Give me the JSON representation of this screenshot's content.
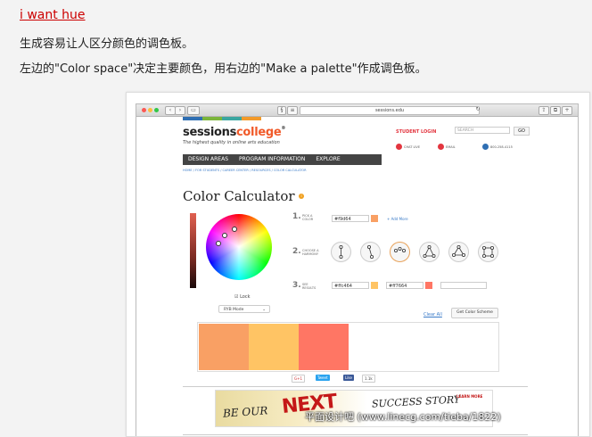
{
  "header": {
    "link_text": "i want hue",
    "line1": "生成容易让人区分颜色的调色板。",
    "line2": "左边的\"Color space\"决定主要颜色，用右边的\"Make a palette\"作成调色板。"
  },
  "browser": {
    "url": "sessions.edu"
  },
  "site": {
    "logo_main": "sessions",
    "logo_accent": "college",
    "logo_suffix": "®",
    "tagline": "The highest quality in online arts education",
    "student_login": "STUDENT LOGIN",
    "search_placeholder": "SEARCH",
    "go_label": "GO",
    "chat_label": "CHAT LIVE",
    "email_label": "EMAIL",
    "phone_label": "800-258-4115",
    "nav": [
      "DESIGN AREAS",
      "PROGRAM INFORMATION",
      "EXPLORE"
    ],
    "breadcrumb": "HOME / FOR STUDENTS / CAREER CENTER / RESOURCES / COLOR CALCULATOR"
  },
  "calculator": {
    "title": "Color Calculator",
    "info_glyph": "i",
    "lock_label": "Lock",
    "mode_label": "RYB Mode",
    "step1_num": "1.",
    "step1_label": "PICK A COLOR",
    "step1_hex": "#f9d64",
    "step1_color": "#f9a064",
    "add_more": "+ Add More",
    "step2_num": "2.",
    "step2_label": "CHOOSE A HARMONY",
    "step3_num": "3.",
    "step3_label": "SEE RESULTS",
    "result1_hex": "#ffc464",
    "result1_color": "#ffc464",
    "result2_hex": "#ff7664",
    "result2_color": "#ff7664",
    "clear_all": "Clear All",
    "get_scheme": "Get Color Scheme",
    "palette": [
      "#f9a064",
      "#ffc464",
      "#ff7664"
    ]
  },
  "share": {
    "gplus": "G+1",
    "tweet": "Tweet",
    "like": "Like",
    "count": "1.1k"
  },
  "banner": {
    "text1": "BE OUR",
    "text2": "NEXT",
    "text3": "SUCCESS STORY",
    "learn_more": "LEARN MORE"
  },
  "watermark": "平面设计吧 (www.linecg.com/tieba/1822)"
}
